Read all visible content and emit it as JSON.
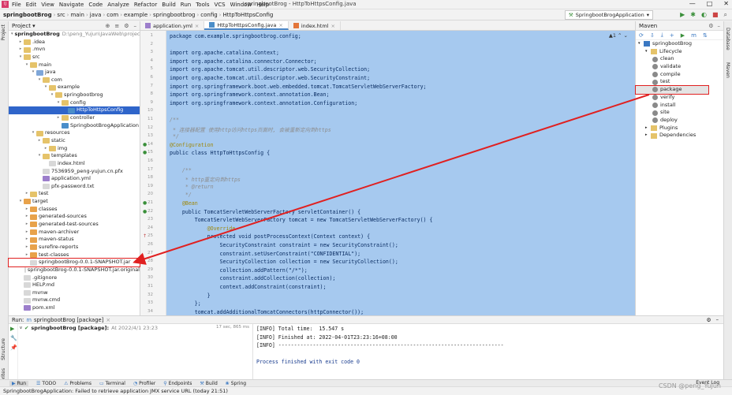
{
  "menu": [
    "File",
    "Edit",
    "View",
    "Navigate",
    "Code",
    "Analyze",
    "Refactor",
    "Build",
    "Run",
    "Tools",
    "VCS",
    "Window",
    "Help"
  ],
  "window_title": "springbootBrog - HttpToHttpsConfig.java",
  "breadcrumbs": [
    "springbootBrog",
    "src",
    "main",
    "java",
    "com",
    "example",
    "springbootbrog",
    "config",
    "HttpToHttpsConfig"
  ],
  "run_config": "SpringbootBrogApplication",
  "project_panel": {
    "title": "Project",
    "rows": [
      {
        "indent": 0,
        "arrow": "v",
        "icon": "fold-b",
        "label": "springbootBrog",
        "extra": "D:\\peng_Yujun\\JavaWeb\\project\\s"
      },
      {
        "indent": 1,
        "arrow": ">",
        "icon": "fold",
        "label": ".idea"
      },
      {
        "indent": 1,
        "arrow": ">",
        "icon": "fold",
        "label": ".mvn"
      },
      {
        "indent": 1,
        "arrow": "v",
        "icon": "fold",
        "label": "src"
      },
      {
        "indent": 2,
        "arrow": "v",
        "icon": "fold",
        "label": "main"
      },
      {
        "indent": 3,
        "arrow": "v",
        "icon": "fold-b",
        "label": "java"
      },
      {
        "indent": 4,
        "arrow": "v",
        "icon": "fold",
        "label": "com"
      },
      {
        "indent": 5,
        "arrow": "v",
        "icon": "fold",
        "label": "example"
      },
      {
        "indent": 6,
        "arrow": "v",
        "icon": "fold",
        "label": "springbootbrog"
      },
      {
        "indent": 7,
        "arrow": "v",
        "icon": "fold",
        "label": "config"
      },
      {
        "indent": 8,
        "arrow": "",
        "icon": "filej",
        "label": "HttpToHttpsConfig",
        "selected": true
      },
      {
        "indent": 7,
        "arrow": ">",
        "icon": "fold",
        "label": "controller"
      },
      {
        "indent": 7,
        "arrow": "",
        "icon": "filej",
        "label": "SpringbootBrogApplication"
      },
      {
        "indent": 3,
        "arrow": "v",
        "icon": "fold",
        "label": "resources"
      },
      {
        "indent": 4,
        "arrow": ">",
        "icon": "fold",
        "label": "static"
      },
      {
        "indent": 5,
        "arrow": ">",
        "icon": "fold",
        "label": "img"
      },
      {
        "indent": 4,
        "arrow": "v",
        "icon": "fold",
        "label": "templates"
      },
      {
        "indent": 5,
        "arrow": "",
        "icon": "file",
        "label": "index.html"
      },
      {
        "indent": 4,
        "arrow": "",
        "icon": "file",
        "label": "7536959_peng-yujun.cn.pfx"
      },
      {
        "indent": 4,
        "arrow": "",
        "icon": "filex",
        "label": "application.yml"
      },
      {
        "indent": 4,
        "arrow": "",
        "icon": "file",
        "label": "pfx-password.txt"
      },
      {
        "indent": 2,
        "arrow": ">",
        "icon": "fold",
        "label": "test"
      },
      {
        "indent": 1,
        "arrow": "v",
        "icon": "fold-o",
        "label": "target"
      },
      {
        "indent": 2,
        "arrow": ">",
        "icon": "fold-o",
        "label": "classes"
      },
      {
        "indent": 2,
        "arrow": ">",
        "icon": "fold-o",
        "label": "generated-sources"
      },
      {
        "indent": 2,
        "arrow": ">",
        "icon": "fold-o",
        "label": "generated-test-sources"
      },
      {
        "indent": 2,
        "arrow": ">",
        "icon": "fold-o",
        "label": "maven-archiver"
      },
      {
        "indent": 2,
        "arrow": ">",
        "icon": "fold-o",
        "label": "maven-status"
      },
      {
        "indent": 2,
        "arrow": ">",
        "icon": "fold-o",
        "label": "surefire-reports"
      },
      {
        "indent": 2,
        "arrow": ">",
        "icon": "fold-o",
        "label": "test-classes"
      },
      {
        "indent": 2,
        "arrow": "",
        "icon": "file",
        "label": "springbootBrog-0.0.1-SNAPSHOT.jar",
        "boxed": true
      },
      {
        "indent": 2,
        "arrow": "",
        "icon": "file",
        "label": "springbootBrog-0.0.1-SNAPSHOT.jar.original"
      },
      {
        "indent": 1,
        "arrow": "",
        "icon": "file",
        "label": ".gitignore"
      },
      {
        "indent": 1,
        "arrow": "",
        "icon": "file",
        "label": "HELP.md"
      },
      {
        "indent": 1,
        "arrow": "",
        "icon": "file",
        "label": "mvnw"
      },
      {
        "indent": 1,
        "arrow": "",
        "icon": "file",
        "label": "mvnw.cmd"
      },
      {
        "indent": 1,
        "arrow": "",
        "icon": "filex",
        "label": "pom.xml"
      }
    ]
  },
  "editor_tabs": [
    "application.yml",
    "HttpToHttpsConfig.java",
    "index.html"
  ],
  "inspection": "▲1 ⌃ ⌄",
  "code_lines": [
    {
      "n": "1",
      "t": "package com.example.springbootbrog.config;"
    },
    {
      "n": "2",
      "t": ""
    },
    {
      "n": "3",
      "t": "import org.apache.catalina.Context;"
    },
    {
      "n": "4",
      "t": "import org.apache.catalina.connector.Connector;"
    },
    {
      "n": "5",
      "t": "import org.apache.tomcat.util.descriptor.web.SecurityCollection;"
    },
    {
      "n": "6",
      "t": "import org.apache.tomcat.util.descriptor.web.SecurityConstraint;"
    },
    {
      "n": "7",
      "t": "import org.springframework.boot.web.embedded.tomcat.TomcatServletWebServerFactory;"
    },
    {
      "n": "8",
      "t": "import org.springframework.context.annotation.Bean;"
    },
    {
      "n": "9",
      "t": "import org.springframework.context.annotation.Configuration;"
    },
    {
      "n": "10",
      "t": ""
    },
    {
      "n": "11",
      "t": "/**"
    },
    {
      "n": "12",
      "t": " * 连接器配置 使用http访问https页面时, 会被重新定向到https"
    },
    {
      "n": "13",
      "t": " */"
    },
    {
      "n": "14",
      "t": "@Configuration"
    },
    {
      "n": "15",
      "t": "public class HttpToHttpsConfig {"
    },
    {
      "n": "16",
      "t": ""
    },
    {
      "n": "17",
      "t": "    /**"
    },
    {
      "n": "18",
      "t": "     * http重定向到https"
    },
    {
      "n": "19",
      "t": "     * @return"
    },
    {
      "n": "20",
      "t": "     */"
    },
    {
      "n": "21",
      "t": "    @Bean"
    },
    {
      "n": "22",
      "t": "    public TomcatServletWebServerFactory servletContainer() {"
    },
    {
      "n": "23",
      "t": "        TomcatServletWebServerFactory tomcat = new TomcatServletWebServerFactory() {"
    },
    {
      "n": "24",
      "t": "            @Override"
    },
    {
      "n": "25",
      "t": "            protected void postProcessContext(Context context) {"
    },
    {
      "n": "26",
      "t": "                SecurityConstraint constraint = new SecurityConstraint();"
    },
    {
      "n": "27",
      "t": "                constraint.setUserConstraint(\"CONFIDENTIAL\");"
    },
    {
      "n": "28",
      "t": "                SecurityCollection collection = new SecurityCollection();"
    },
    {
      "n": "29",
      "t": "                collection.addPattern(\"/*\");"
    },
    {
      "n": "30",
      "t": "                constraint.addCollection(collection);"
    },
    {
      "n": "31",
      "t": "                context.addConstraint(constraint);"
    },
    {
      "n": "32",
      "t": "            }"
    },
    {
      "n": "33",
      "t": "        };"
    },
    {
      "n": "34",
      "t": "        tomcat.addAdditionalTomcatConnectors(httpConnector());"
    }
  ],
  "maven": {
    "title": "Maven",
    "rows": [
      {
        "indent": 0,
        "arrow": "v",
        "label": "springbootBrog",
        "kind": "root"
      },
      {
        "indent": 1,
        "arrow": "v",
        "label": "Lifecycle",
        "kind": "folder"
      },
      {
        "indent": 2,
        "label": "clean",
        "kind": "goal"
      },
      {
        "indent": 2,
        "label": "validate",
        "kind": "goal"
      },
      {
        "indent": 2,
        "label": "compile",
        "kind": "goal"
      },
      {
        "indent": 2,
        "label": "test",
        "kind": "goal"
      },
      {
        "indent": 2,
        "label": "package",
        "kind": "goal",
        "boxed": true
      },
      {
        "indent": 2,
        "label": "verify",
        "kind": "goal"
      },
      {
        "indent": 2,
        "label": "install",
        "kind": "goal"
      },
      {
        "indent": 2,
        "label": "site",
        "kind": "goal"
      },
      {
        "indent": 2,
        "label": "deploy",
        "kind": "goal"
      },
      {
        "indent": 1,
        "arrow": ">",
        "label": "Plugins",
        "kind": "folder"
      },
      {
        "indent": 1,
        "arrow": ">",
        "label": "Dependencies",
        "kind": "folder"
      }
    ]
  },
  "run": {
    "tab_label": "Run:",
    "tab_name": "springbootBrog [package]",
    "tree_item": "springbootBrog [package]:",
    "tree_time": "At 2022/4/1 23:23",
    "tree_duration": "17 sec, 865 ms",
    "console": [
      "[INFO] Total time:  15.547 s",
      "[INFO] Finished at: 2022-04-01T23:23:16+08:00",
      "[INFO] ------------------------------------------------------------------------",
      "",
      "Process finished with exit code 0"
    ]
  },
  "bottom_tabs": [
    "Run",
    "TODO",
    "Problems",
    "Terminal",
    "Profiler",
    "Endpoints",
    "Build",
    "Spring"
  ],
  "event_log": "Event Log",
  "status": "SpringbootBrogApplication: Failed to retrieve application JMX service URL (today 21:51)",
  "watermark": "CSDN @peng_YuJun",
  "left_tool_labels": [
    "Project",
    "Structure",
    "Favorites"
  ],
  "right_tool_labels": [
    "Maven",
    "Database"
  ],
  "colors": {
    "selection": "#2f65ca",
    "code_selection": "#a6c9ef",
    "annotation_box": "#e02020"
  }
}
